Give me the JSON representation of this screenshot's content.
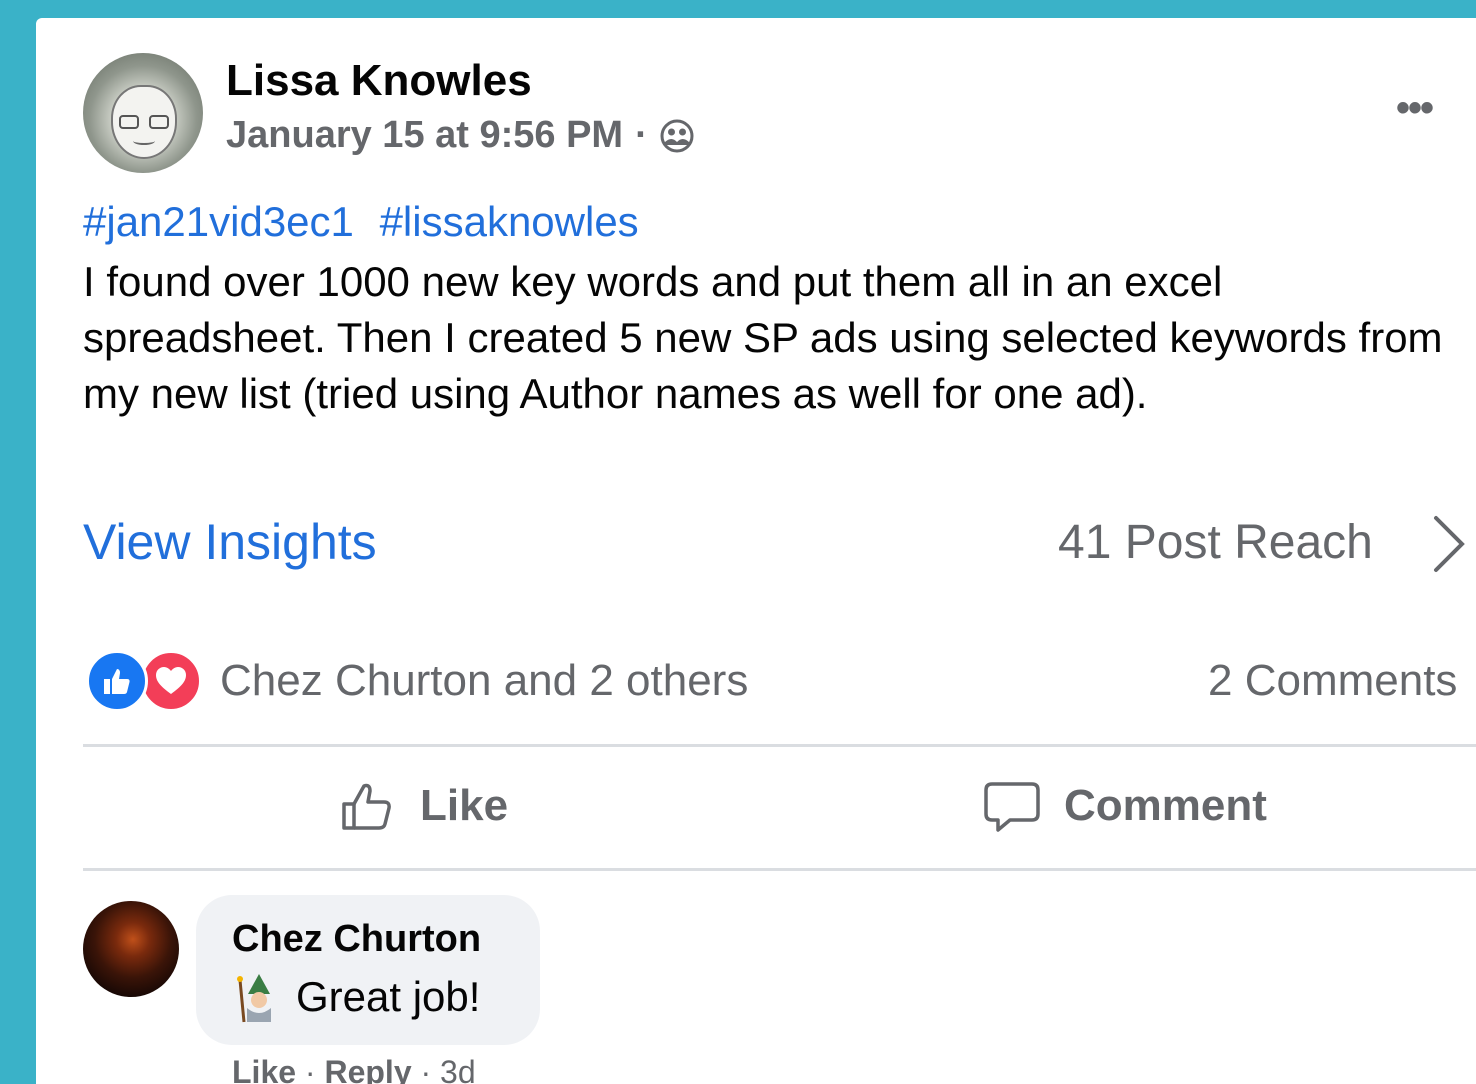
{
  "post": {
    "author": "Lissa Knowles",
    "timestamp": "January 15 at 9:56 PM",
    "separator": "·",
    "privacy_icon": "friends-icon",
    "more_label": "•••",
    "hashtags": [
      "#jan21vid3ec1",
      "#lissaknowles"
    ],
    "body": "I found over 1000 new key words and put them all in an excel spreadsheet.  Then I created 5 new SP ads using selected keywords from my new list (tried using Author names as well for one ad).",
    "view_insights": "View Insights",
    "post_reach": "41 Post Reach"
  },
  "reactions": {
    "types": [
      "like",
      "love"
    ],
    "summary": "Chez Churton and 2 others",
    "comments_count": "2 Comments"
  },
  "actions": {
    "like": "Like",
    "comment": "Comment"
  },
  "comments": [
    {
      "author": "Chez Churton",
      "emoji_icon": "mage-icon",
      "text": "Great job!",
      "like": "Like",
      "reply": "Reply",
      "sep": "·",
      "time": "3d"
    }
  ],
  "colors": {
    "background": "#3AB2C8",
    "link": "#216FDB",
    "secondary_text": "#65676B",
    "like_blue": "#1877F2",
    "love_red": "#F33E58"
  }
}
